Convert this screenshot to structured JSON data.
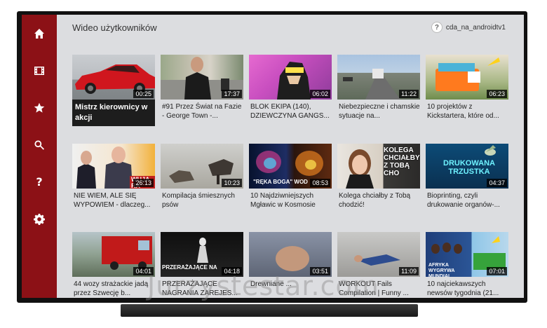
{
  "header": {
    "title": "Wideo użytkowników",
    "account_name": "cda_na_androidtv1",
    "account_icon": "?"
  },
  "sidebar": {
    "items": [
      {
        "name": "home",
        "icon": "home-icon"
      },
      {
        "name": "videos",
        "icon": "film-icon"
      },
      {
        "name": "favorites",
        "icon": "star-icon"
      },
      {
        "name": "search",
        "icon": "search-icon"
      },
      {
        "name": "help",
        "icon": "help-icon",
        "glyph": "?"
      },
      {
        "name": "settings",
        "icon": "gear-icon"
      }
    ],
    "color": "#8c1116"
  },
  "videos": [
    {
      "title": "Mistrz kierownicy w akcji",
      "duration": "00:25",
      "focused": true
    },
    {
      "title": "#91 Przez Świat na Fazie - George Town -...",
      "duration": "17:37"
    },
    {
      "title": "BLOK EKIPA (140), DZIEWCZYNA GANGS...",
      "duration": "06:02"
    },
    {
      "title": "Niebezpieczne i chamskie sytuacje na...",
      "duration": "11:22"
    },
    {
      "title": "10 projektów z Kickstartera, które od...",
      "duration": "06:23"
    },
    {
      "title": "NIE WIEM, ALE SIĘ WYPOWIEM - dlaczeg...",
      "duration": "26:13",
      "overlay": "WUJA RA"
    },
    {
      "title": "Kompilacja śmiesznych psów",
      "duration": "10:23"
    },
    {
      "title": "10 Najdziwniejszych Mgławic w Kosmosie",
      "duration": "08:53",
      "overlay": "\"RĘKA BOGA\"   WOD"
    },
    {
      "title": "Kolega chciałby z Tobą chodzić!",
      "duration": "",
      "overlay": "KOLEGA CHCIAŁBY Z TOBĄ CHO"
    },
    {
      "title": "Bioprinting, czyli drukowanie organów-...",
      "duration": "04:37",
      "overlay": "DRUKOWANA TRZUSTKA"
    },
    {
      "title": "44 wozy strażackie jadą przez Szwecję b...",
      "duration": "04:01"
    },
    {
      "title": "PRZERAŻAJĄCE NAGRANIA ZAREJES...",
      "duration": "04:18",
      "overlay": "PRZERAŻAJĄCE NA"
    },
    {
      "title": "Drewniane ...",
      "duration": "03:51"
    },
    {
      "title": "WORKOUT Fails Compilation | Funny ...",
      "duration": "11:09"
    },
    {
      "title": "10 najciekawszych newsów tygodnia (21...",
      "duration": "07:01",
      "overlay": "AFRYKA WYGRYWA MUNDIAL"
    }
  ],
  "watermark": "Jurzystestar.com"
}
